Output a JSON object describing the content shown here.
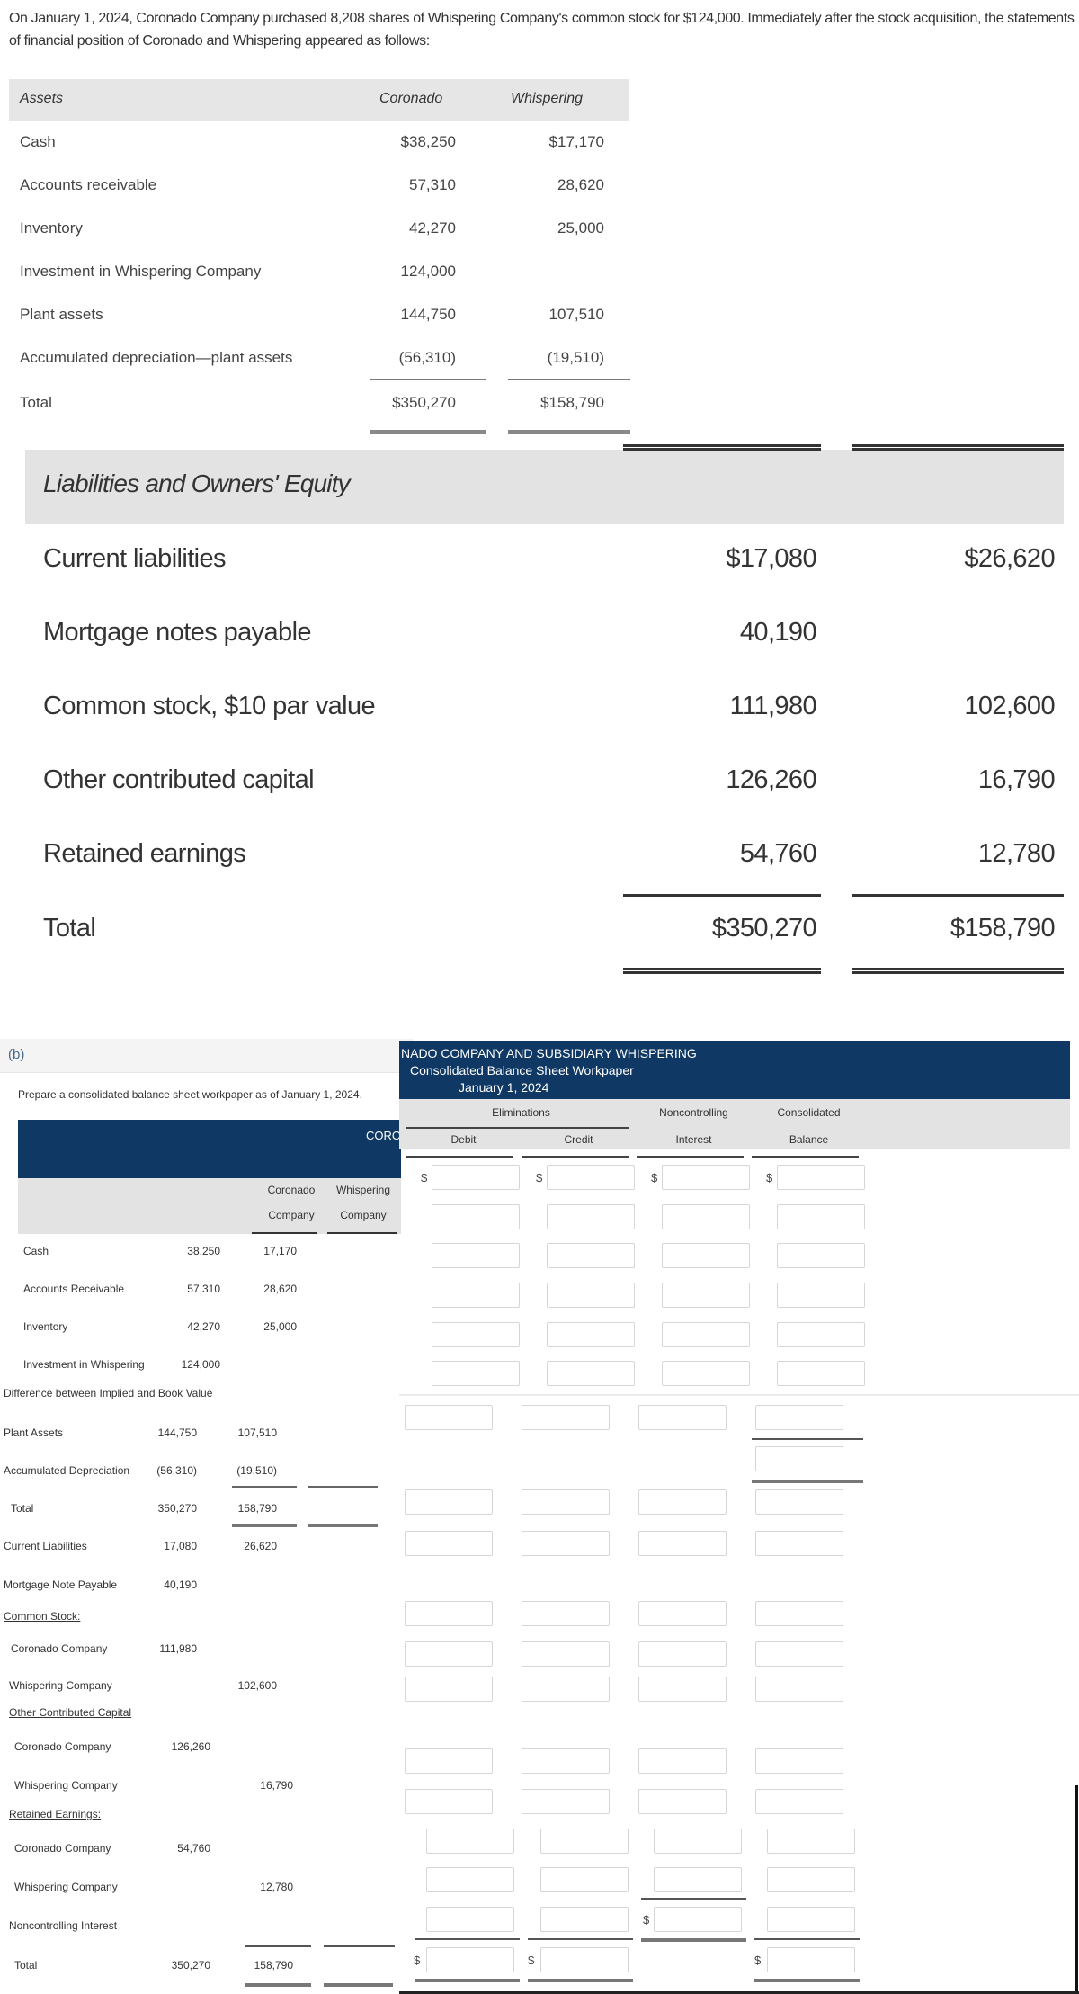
{
  "intro": "On January 1, 2024, Coronado Company purchased 8,208 shares of Whispering Company's common stock for $124,000. Immediately after the stock acquisition, the statements of financial position of Coronado and Whispering appeared as follows:",
  "assets_table": {
    "headers": {
      "label": "Assets",
      "col1": "Coronado",
      "col2": "Whispering"
    },
    "rows": [
      {
        "label": "Cash",
        "coronado": "$38,250",
        "whispering": "$17,170"
      },
      {
        "label": "Accounts receivable",
        "coronado": "57,310",
        "whispering": "28,620"
      },
      {
        "label": "Inventory",
        "coronado": "42,270",
        "whispering": "25,000"
      },
      {
        "label": "Investment in Whispering Company",
        "coronado": "124,000",
        "whispering": ""
      },
      {
        "label": "Plant assets",
        "coronado": "144,750",
        "whispering": "107,510"
      },
      {
        "label": "Accumulated depreciation—plant assets",
        "coronado": "(56,310)",
        "whispering": "(19,510)"
      },
      {
        "label": "Total",
        "coronado": "$350,270",
        "whispering": "$158,790"
      }
    ]
  },
  "liabilities_table": {
    "header": "Liabilities and Owners' Equity",
    "rows": [
      {
        "label": "Current liabilities",
        "coronado": "$17,080",
        "whispering": "$26,620"
      },
      {
        "label": "Mortgage notes payable",
        "coronado": "40,190",
        "whispering": ""
      },
      {
        "label": "Common stock, $10 par value",
        "coronado": "111,980",
        "whispering": "102,600"
      },
      {
        "label": "Other contributed capital",
        "coronado": "126,260",
        "whispering": "16,790"
      },
      {
        "label": "Retained earnings",
        "coronado": "54,760",
        "whispering": "12,780"
      },
      {
        "label": "Total",
        "coronado": "$350,270",
        "whispering": "$158,790"
      }
    ]
  },
  "part_b": {
    "label": "(b)",
    "prompt": "Prepare a consolidated balance sheet workpaper as of January 1, 2024.",
    "workpaper": {
      "title_clipped_left": "CORO",
      "title_line1": "NADO COMPANY AND SUBSIDIARY WHISPERING",
      "title_line2": "Consolidated Balance Sheet Workpaper",
      "title_line3": "January 1, 2024",
      "col_coronado": [
        "Coronado",
        "Company"
      ],
      "col_whispering": [
        "Whispering",
        "Company"
      ],
      "eliminations": "Eliminations",
      "debit": "Debit",
      "credit": "Credit",
      "nci": [
        "Noncontrolling",
        "Interest"
      ],
      "consolidated": [
        "Consolidated",
        "Balance"
      ],
      "currency_symbol": "$",
      "rows": [
        {
          "label": "Cash",
          "coronado": "38,250",
          "whispering": "17,170"
        },
        {
          "label": "Accounts Receivable",
          "coronado": "57,310",
          "whispering": "28,620"
        },
        {
          "label": "Inventory",
          "coronado": "42,270",
          "whispering": "25,000"
        },
        {
          "label": "Investment in Whispering",
          "coronado": "124,000",
          "whispering": ""
        },
        {
          "label": "Difference between Implied and Book Value",
          "coronado": "",
          "whispering": ""
        },
        {
          "label": "Plant Assets",
          "coronado": "144,750",
          "whispering": "107,510"
        },
        {
          "label": "Accumulated Depreciation",
          "coronado": "(56,310)",
          "whispering": "(19,510)"
        },
        {
          "label": "Total",
          "coronado": "350,270",
          "whispering": "158,790"
        },
        {
          "label": "Current Liabilities",
          "coronado": "17,080",
          "whispering": "26,620"
        },
        {
          "label": "Mortgage Note Payable",
          "coronado": "40,190",
          "whispering": ""
        },
        {
          "label": "Common Stock:",
          "coronado": "",
          "whispering": ""
        },
        {
          "label": "Coronado Company",
          "coronado": "111,980",
          "whispering": ""
        },
        {
          "label": "Whispering Company",
          "coronado": "",
          "whispering": "102,600"
        },
        {
          "label": "Other Contributed Capital",
          "coronado": "",
          "whispering": ""
        },
        {
          "label": "Coronado Company",
          "coronado": "126,260",
          "whispering": ""
        },
        {
          "label": "Whispering Company",
          "coronado": "",
          "whispering": "16,790"
        },
        {
          "label": "Retained Earnings:",
          "coronado": "",
          "whispering": ""
        },
        {
          "label": "Coronado Company",
          "coronado": "54,760",
          "whispering": ""
        },
        {
          "label": "Whispering Company",
          "coronado": "",
          "whispering": "12,780"
        },
        {
          "label": "Noncontrolling Interest",
          "coronado": "",
          "whispering": ""
        },
        {
          "label": "Total",
          "coronado": "350,270",
          "whispering": "158,790"
        }
      ]
    }
  }
}
